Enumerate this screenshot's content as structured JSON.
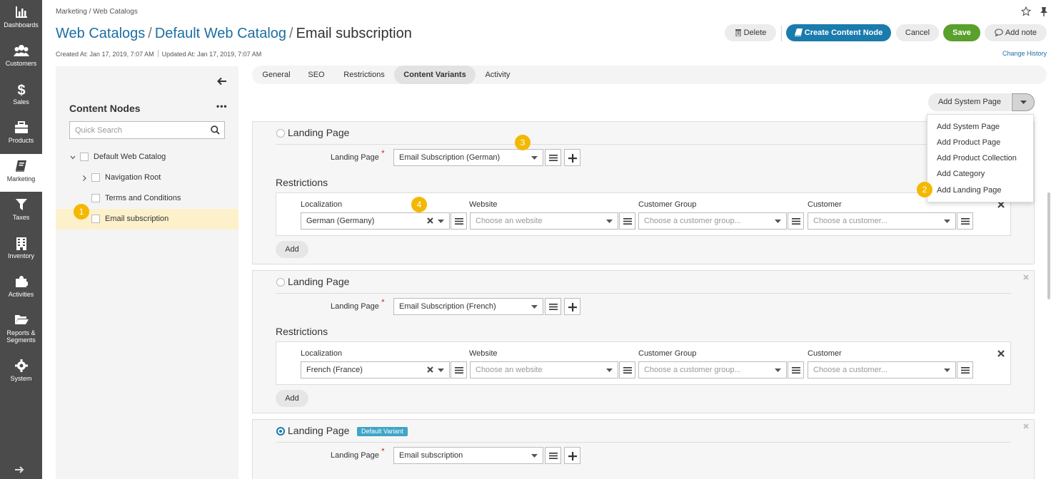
{
  "nav": {
    "items": [
      {
        "key": "dashboards",
        "label": "Dashboards",
        "icon": "bar-chart-icon"
      },
      {
        "key": "customers",
        "label": "Customers",
        "icon": "users-icon"
      },
      {
        "key": "sales",
        "label": "Sales",
        "icon": "dollar-icon"
      },
      {
        "key": "products",
        "label": "Products",
        "icon": "briefcase-icon"
      },
      {
        "key": "marketing",
        "label": "Marketing",
        "icon": "book-icon"
      },
      {
        "key": "taxes",
        "label": "Taxes",
        "icon": "filter-icon"
      },
      {
        "key": "inventory",
        "label": "Inventory",
        "icon": "building-icon"
      },
      {
        "key": "activities",
        "label": "Activities",
        "icon": "puzzle-icon"
      },
      {
        "key": "reports",
        "label": "Reports &",
        "label2": "Segments",
        "icon": "folder-icon"
      },
      {
        "key": "system",
        "label": "System",
        "icon": "gear-icon"
      }
    ],
    "active": "marketing"
  },
  "header": {
    "breadcrumb": "Marketing / Web Catalogs",
    "title_parts": [
      "Web Catalogs",
      "Default Web Catalog",
      "Email subscription"
    ],
    "separator": "/",
    "created": "Created At: Jan 17, 2019, 7:07 AM",
    "updated": "Updated At: Jan 17, 2019, 7:07 AM",
    "change_history": "Change History"
  },
  "toolbar": {
    "delete": "Delete",
    "create_node": "Create Content Node",
    "cancel": "Cancel",
    "save": "Save",
    "add_note": "Add note"
  },
  "tree": {
    "heading": "Content Nodes",
    "more": "•••",
    "search_placeholder": "Quick Search",
    "nodes": [
      {
        "label": "Default Web Catalog",
        "expanded": true,
        "level": 0
      },
      {
        "label": "Navigation Root",
        "expanded": false,
        "level": 1
      },
      {
        "label": "Terms and Conditions",
        "level": 1
      },
      {
        "label": "Email subscription",
        "level": 1,
        "selected": true
      }
    ]
  },
  "tabs": [
    "General",
    "SEO",
    "Restrictions",
    "Content Variants",
    "Activity"
  ],
  "active_tab": "Content Variants",
  "add_page": {
    "label": "Add System Page",
    "menu": [
      "Add System Page",
      "Add Product Page",
      "Add Product Collection",
      "Add Category",
      "Add Landing Page"
    ]
  },
  "variants": [
    {
      "title": "Landing Page",
      "field_label": "Landing Page",
      "value": "Email Subscription (German)",
      "restrictions_label": "Restrictions",
      "columns": [
        "Localization",
        "Website",
        "Customer Group",
        "Customer"
      ],
      "localization": "German (Germany)",
      "website_ph": "Choose an website",
      "group_ph": "Choose a customer group...",
      "customer_ph": "Choose a customer...",
      "add": "Add"
    },
    {
      "title": "Landing Page",
      "field_label": "Landing Page",
      "value": "Email Subscription (French)",
      "restrictions_label": "Restrictions",
      "columns": [
        "Localization",
        "Website",
        "Customer Group",
        "Customer"
      ],
      "localization": "French (France)",
      "website_ph": "Choose an website",
      "group_ph": "Choose a customer group...",
      "customer_ph": "Choose a customer...",
      "add": "Add"
    },
    {
      "title": "Landing Page",
      "badge": "Default Variant",
      "field_label": "Landing Page",
      "value": "Email subscription"
    }
  ],
  "markers": [
    "1",
    "2",
    "3",
    "4"
  ],
  "colors": {
    "nav_bg": "#4b4b4b",
    "link": "#1c6ea4",
    "primary": "#1a7bad",
    "success": "#5aa02c",
    "marker": "#f4b800",
    "selected_row": "#fdf1cc",
    "badge": "#3fa5c7"
  }
}
